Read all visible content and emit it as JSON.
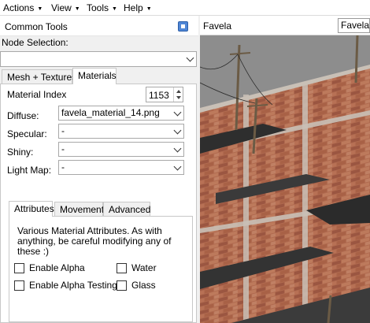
{
  "menu": [
    {
      "label": "Actions"
    },
    {
      "label": "View"
    },
    {
      "label": "Tools"
    },
    {
      "label": "Help"
    }
  ],
  "common_tools": {
    "title": "Common Tools",
    "node_selection_label": "Node Selection:",
    "node_selection_value": ""
  },
  "tabs": [
    {
      "label": "Mesh + Textures"
    },
    {
      "label": "Materials"
    }
  ],
  "materials": {
    "material_index_label": "Material Index",
    "material_index_value": "1153",
    "diffuse_label": "Diffuse:",
    "diffuse_value": "favela_material_14.png",
    "specular_label": "Specular:",
    "specular_value": "-",
    "shiny_label": "Shiny:",
    "shiny_value": "-",
    "light_map_label": "Light Map:",
    "light_map_value": "-"
  },
  "subtabs": [
    {
      "label": "Attributes"
    },
    {
      "label": "Movement"
    },
    {
      "label": "Advanced"
    }
  ],
  "attributes": {
    "description": "Various Material Attributes. As with anything, be careful modifying any of these :)",
    "checkboxes": [
      {
        "label": "Enable Alpha",
        "checked": false
      },
      {
        "label": "Water",
        "checked": false
      },
      {
        "label": "Enable Alpha Testing",
        "checked": false
      },
      {
        "label": "Glass",
        "checked": false
      }
    ]
  },
  "viewport": {
    "title": "Favela",
    "scene_value": "Favela"
  },
  "colors": {
    "brick": "#b06a4f",
    "mortar": "#c9c0b6",
    "sky": "#8d8d8d",
    "pin_blue": "#4f86d6"
  }
}
